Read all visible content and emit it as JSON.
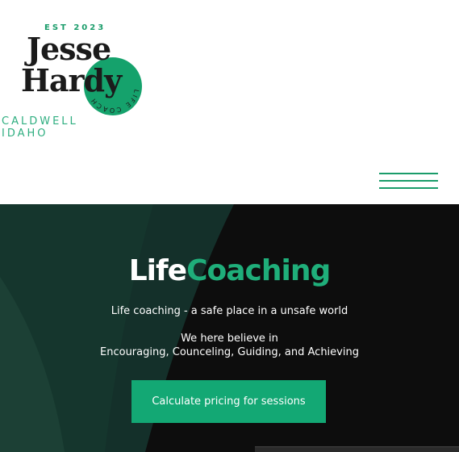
{
  "header": {
    "logo": {
      "est": "EST 2023",
      "name_first": "Jesse",
      "name_last": "Hardy",
      "circle_text": "LIFE COACH",
      "city": "CALDWELL",
      "state": "IDAHO"
    },
    "menu_icon": "hamburger-menu-icon"
  },
  "hero": {
    "title_part1": "Life",
    "title_part2": "Coaching",
    "tagline": "Life coaching - a safe place in a unsafe world",
    "belief_line1": "We here believe in",
    "belief_line2": "Encouraging, Counceling, Guiding, and Achieving",
    "cta_label": "Calculate pricing for sessions"
  },
  "colors": {
    "accent": "#13a874",
    "dark_bg": "#0d0d0d",
    "dark_green_shape": "#1a3a2e",
    "text_dark": "#1b1b1b"
  }
}
